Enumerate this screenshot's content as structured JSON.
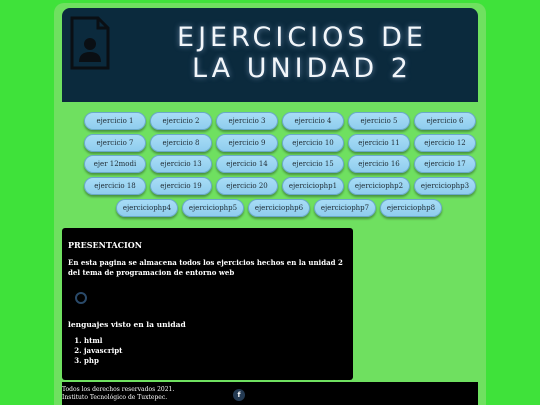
{
  "header": {
    "title": "EJERCICIOS DE LA UNIDAD 2",
    "icon": "document-user-icon"
  },
  "nav": {
    "rows": [
      [
        "ejercicio 1",
        "ejercicio 2",
        "ejercicio 3",
        "ejercicio 4",
        "ejercicio 5",
        "ejercicio 6"
      ],
      [
        "ejercicio 7",
        "ejercicio 8",
        "ejercicio 9",
        "ejercicio 10",
        "ejercicio 11",
        "ejercicio 12"
      ],
      [
        "ejer 12modi",
        "ejercicio 13",
        "ejercicio 14",
        "ejercicio 15",
        "ejercicio 16",
        "ejercicio 17"
      ],
      [
        "ejercicio 18",
        "ejercicio 19",
        "ejercicio 20",
        "ejerciciophp1",
        "ejerciciophp2",
        "ejerciciophp3"
      ],
      [
        "ejerciciophp4",
        "ejerciciophp5",
        "ejerciciophp6",
        "ejerciciophp7",
        "ejerciciophp8"
      ]
    ]
  },
  "content": {
    "heading": "PRESENTACION",
    "description": "En esta pagina se almacena todos los ejercicios hechos en la unidad 2 del tema de programacion de entorno web",
    "languages_title": "lenguajes visto en la unidad",
    "languages": [
      "html",
      "javascript",
      "php"
    ]
  },
  "footer": {
    "copyright": "Todos los derechos reservados 2021. Instituto Tecnológico de Tuxtepec.",
    "facebook_label": "f"
  },
  "colors": {
    "background": "#3fe23a",
    "panel": "#6fe060",
    "header": "#0b2a3d",
    "button": "#a8dcf6"
  }
}
